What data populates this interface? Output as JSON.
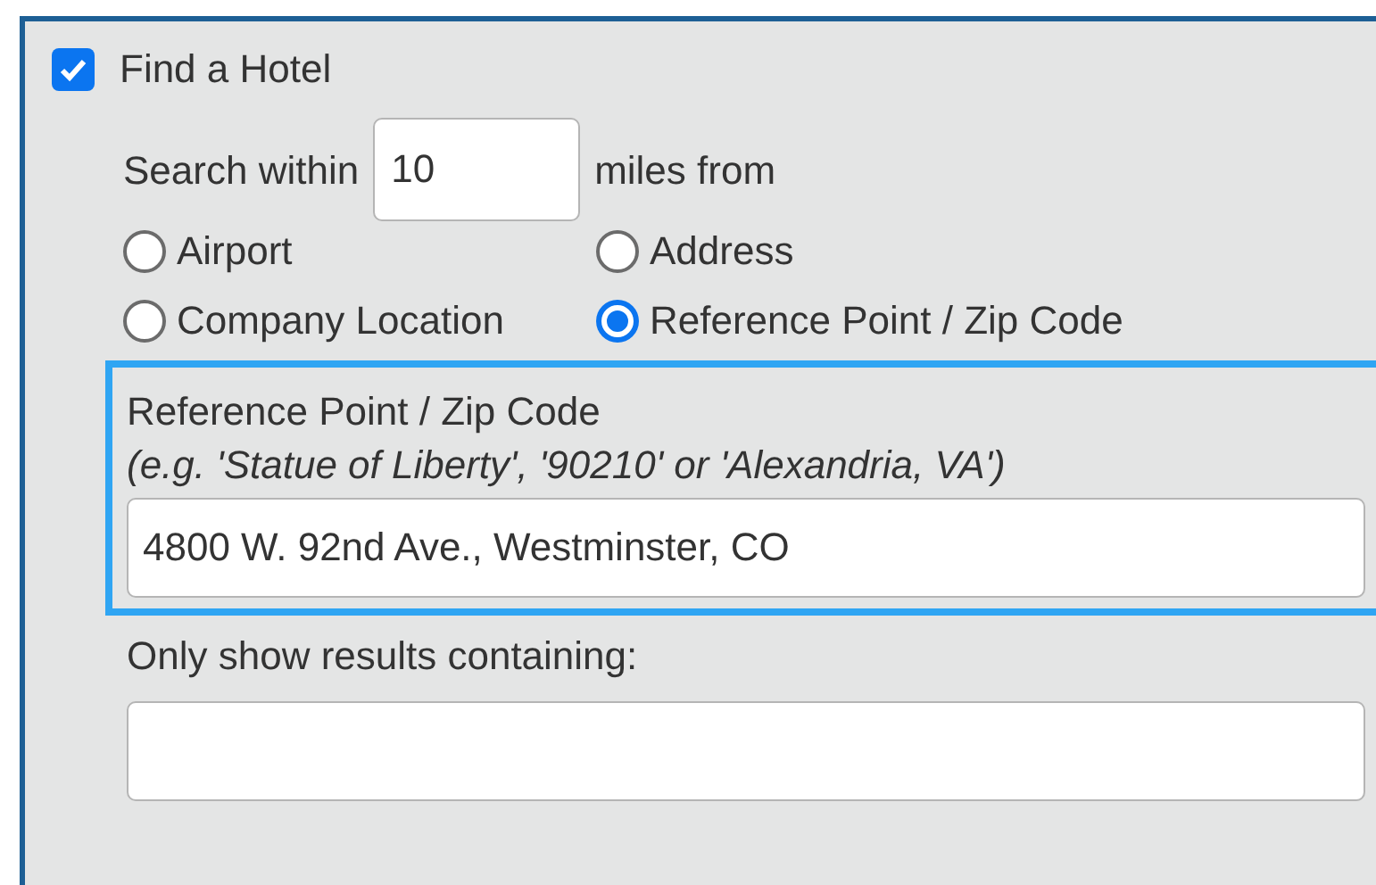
{
  "find_hotel": {
    "label": "Find a Hotel",
    "checked": true
  },
  "search_within": {
    "label": "Search within",
    "value": "10",
    "suffix": "miles from"
  },
  "location_options": [
    {
      "label": "Airport",
      "selected": false
    },
    {
      "label": "Address",
      "selected": false
    },
    {
      "label": "Company Location",
      "selected": false
    },
    {
      "label": "Reference Point / Zip Code",
      "selected": true
    }
  ],
  "reference_point": {
    "label": "Reference Point / Zip Code",
    "hint": "(e.g. 'Statue of Liberty', '90210' or 'Alexandria, VA')",
    "value": "4800 W. 92nd Ave., Westminster, CO",
    "focused": true
  },
  "filter": {
    "label": "Only show results containing:"
  }
}
